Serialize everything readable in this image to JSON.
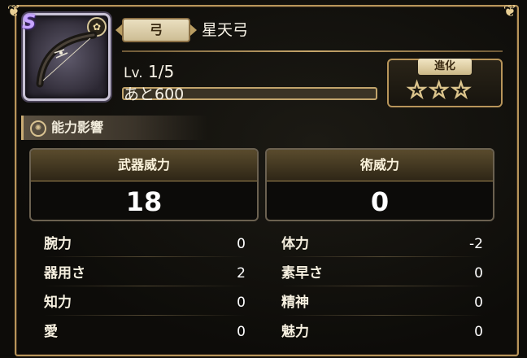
{
  "weapon": {
    "type_tag": "弓",
    "name": "星天弓",
    "level_prefix": "Lv.",
    "level": "1/5",
    "remaining": "あと600",
    "exp_fraction": 0.0
  },
  "evolution": {
    "label": "進化",
    "stars_total": 3,
    "stars_filled": 0,
    "stars_text": "☆☆☆"
  },
  "section": {
    "title": "能力影響"
  },
  "power": {
    "weapon_power_label": "武器威力",
    "weapon_power_value": "18",
    "art_power_label": "術威力",
    "art_power_value": "0"
  },
  "stats": {
    "left": [
      {
        "label": "腕力",
        "value": "0"
      },
      {
        "label": "器用さ",
        "value": "2"
      },
      {
        "label": "知力",
        "value": "0"
      },
      {
        "label": "愛",
        "value": "0"
      }
    ],
    "right": [
      {
        "label": "体力",
        "value": "-2"
      },
      {
        "label": "素早さ",
        "value": "0"
      },
      {
        "label": "精神",
        "value": "0"
      },
      {
        "label": "魅力",
        "value": "0"
      }
    ]
  },
  "colors": {
    "frame_gold": "#b8955a",
    "text_light": "#f2ecdf",
    "panel_bg": "#0c0b09"
  },
  "icons": {
    "rarity": "rarity-s-icon",
    "weapon": "bow-icon",
    "gear": "gear-icon",
    "star": "star-outline-icon"
  }
}
